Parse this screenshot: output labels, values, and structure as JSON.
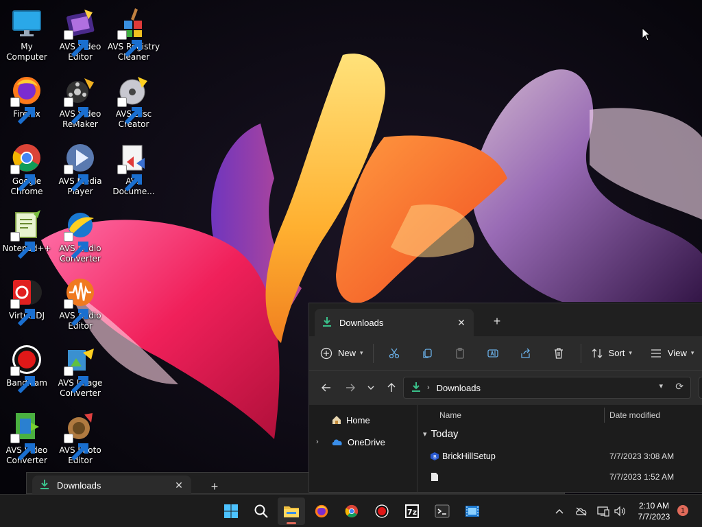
{
  "desktop": {
    "icons": [
      {
        "label": "My Computer"
      },
      {
        "label": "AVS Video Editor"
      },
      {
        "label": "AVS Registry Cleaner"
      },
      {
        "label": "Firefox"
      },
      {
        "label": "AVS Video ReMaker"
      },
      {
        "label": "AVS Disc Creator"
      },
      {
        "label": "Google Chrome"
      },
      {
        "label": "AVS Media Player"
      },
      {
        "label": "AVS Docume..."
      },
      {
        "label": "Notepad++"
      },
      {
        "label": "AVS Audio Converter"
      },
      {
        "label": "VirtualDJ"
      },
      {
        "label": "AVS Audio Editor"
      },
      {
        "label": "Bandicam"
      },
      {
        "label": "AVS Image Converter"
      },
      {
        "label": "AVS Video Converter"
      },
      {
        "label": "AVS Photo Editor"
      }
    ]
  },
  "explorer": {
    "tab_title": "Downloads",
    "new_label": "New",
    "sort_label": "Sort",
    "view_label": "View",
    "address_path": "Downloads",
    "nav": {
      "home": "Home",
      "onedrive": "OneDrive"
    },
    "columns": {
      "name": "Name",
      "date": "Date modified"
    },
    "group": "Today",
    "files": [
      {
        "name": "BrickHillSetup",
        "date": "7/7/2023 3:08 AM"
      },
      {
        "name": "",
        "date": "7/7/2023 1:52 AM"
      }
    ]
  },
  "explorer2": {
    "tab_title": "Downloads"
  },
  "taskbar": {
    "time": "2:10 AM",
    "date": "7/7/2023",
    "notifications": "1",
    "accent": "#e06a5a"
  }
}
